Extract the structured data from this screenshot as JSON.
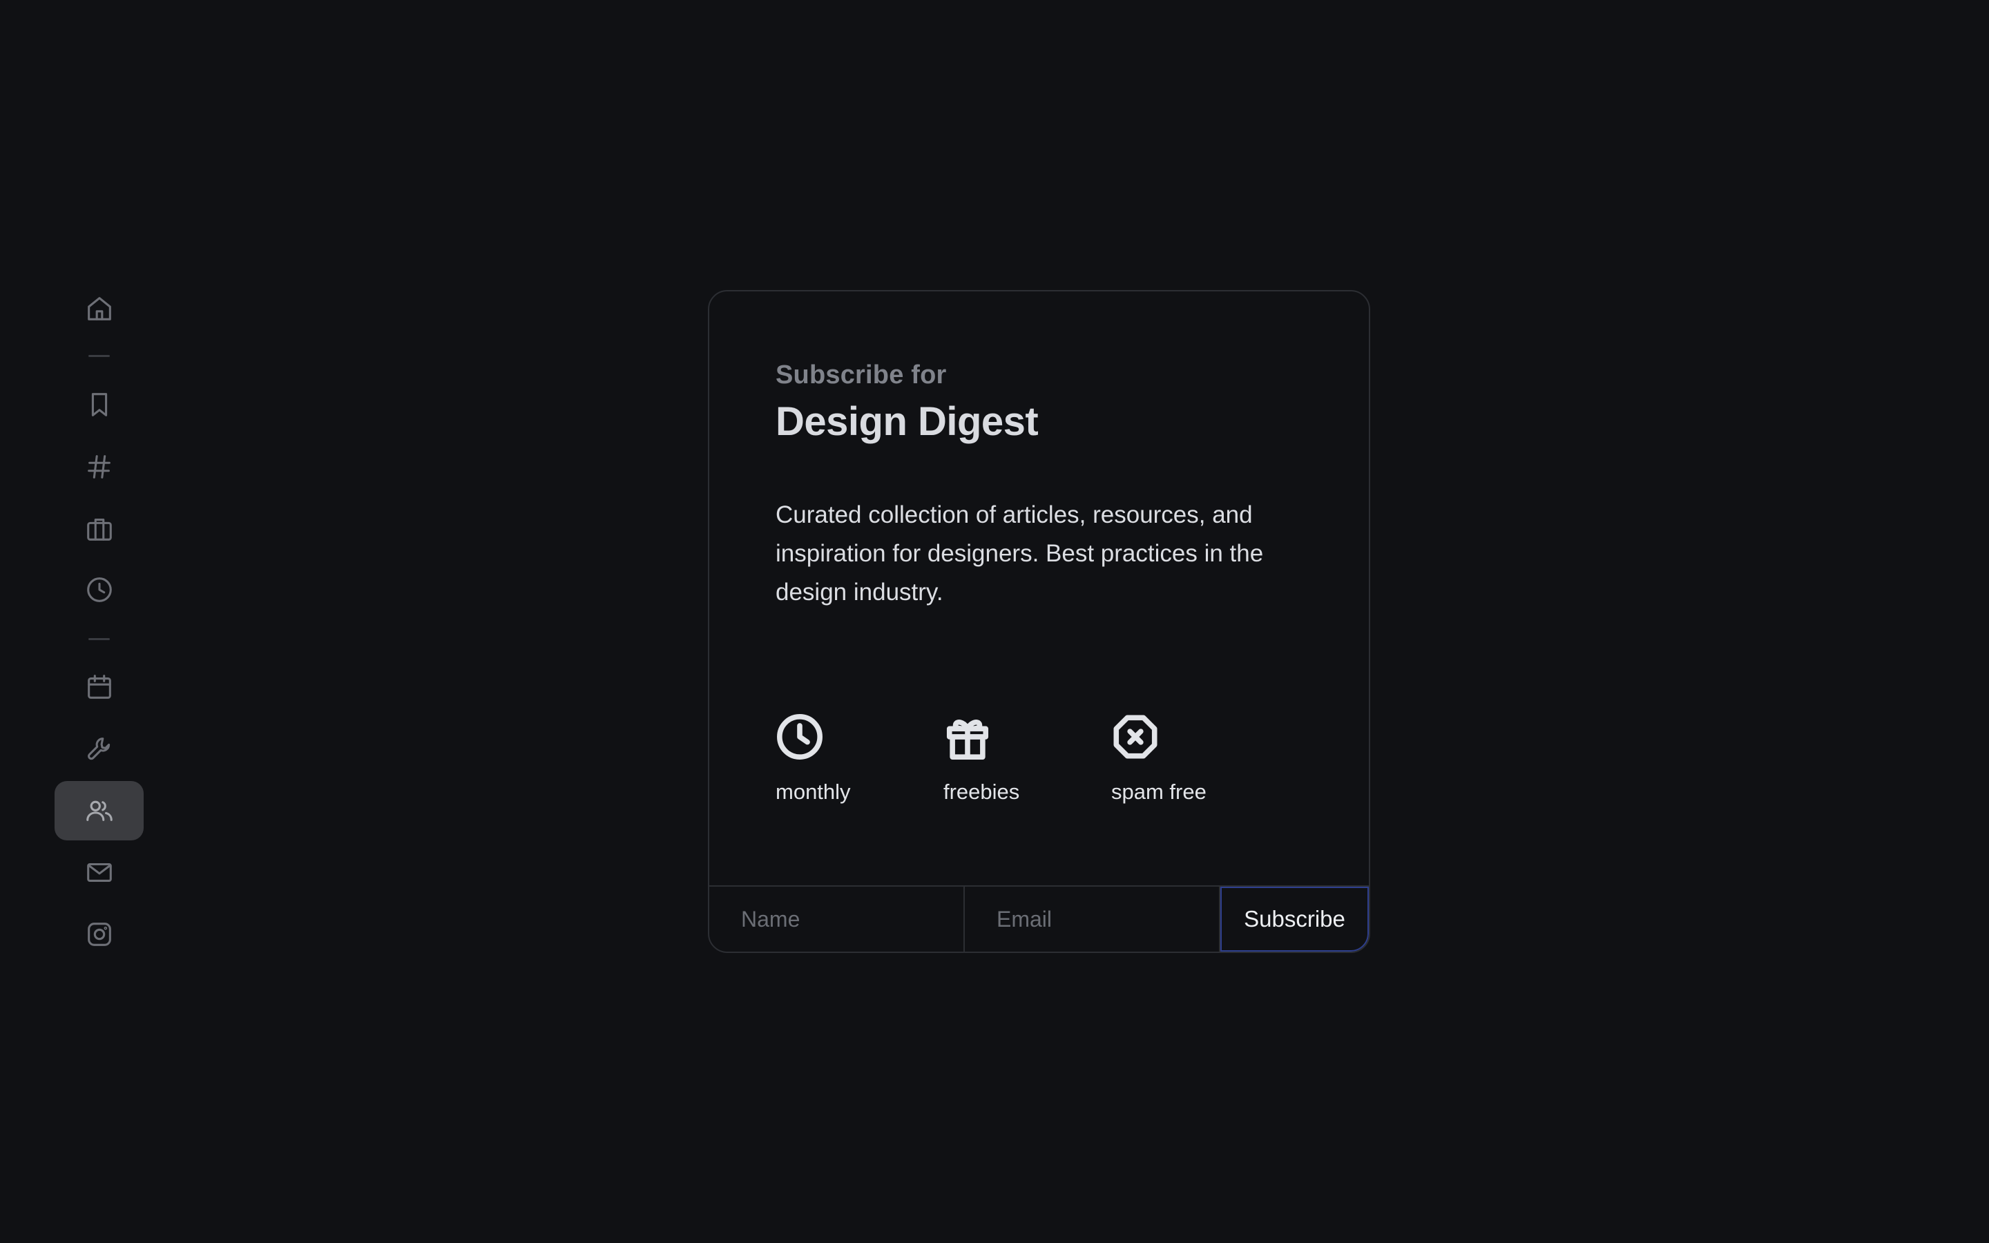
{
  "sidebar": {
    "items": [
      {
        "name": "home",
        "icon": "home-icon",
        "active": false
      },
      {
        "name": "bookmarks",
        "icon": "bookmark-icon",
        "active": false
      },
      {
        "name": "tags",
        "icon": "hash-icon",
        "active": false
      },
      {
        "name": "work",
        "icon": "briefcase-icon",
        "active": false
      },
      {
        "name": "history",
        "icon": "clock-icon",
        "active": false
      },
      {
        "name": "calendar",
        "icon": "calendar-icon",
        "active": false
      },
      {
        "name": "tools",
        "icon": "wrench-icon",
        "active": false
      },
      {
        "name": "community",
        "icon": "users-icon",
        "active": true
      },
      {
        "name": "mail",
        "icon": "mail-icon",
        "active": false
      },
      {
        "name": "instagram",
        "icon": "instagram-icon",
        "active": false
      }
    ]
  },
  "card": {
    "kicker": "Subscribe for",
    "title": "Design Digest",
    "description": "Curated collection of articles, resources, and inspiration for designers. Best practices in the design industry.",
    "features": [
      {
        "icon": "clock-icon",
        "label": "monthly"
      },
      {
        "icon": "gift-icon",
        "label": "freebies"
      },
      {
        "icon": "octagon-x-icon",
        "label": "spam free"
      }
    ],
    "form": {
      "name_placeholder": "Name",
      "email_placeholder": "Email",
      "submit_label": "Subscribe"
    }
  },
  "colors": {
    "background": "#101114",
    "card_border": "#2c2e33",
    "accent_border": "#2e3f8e",
    "active_nav": "#3b3c40"
  }
}
